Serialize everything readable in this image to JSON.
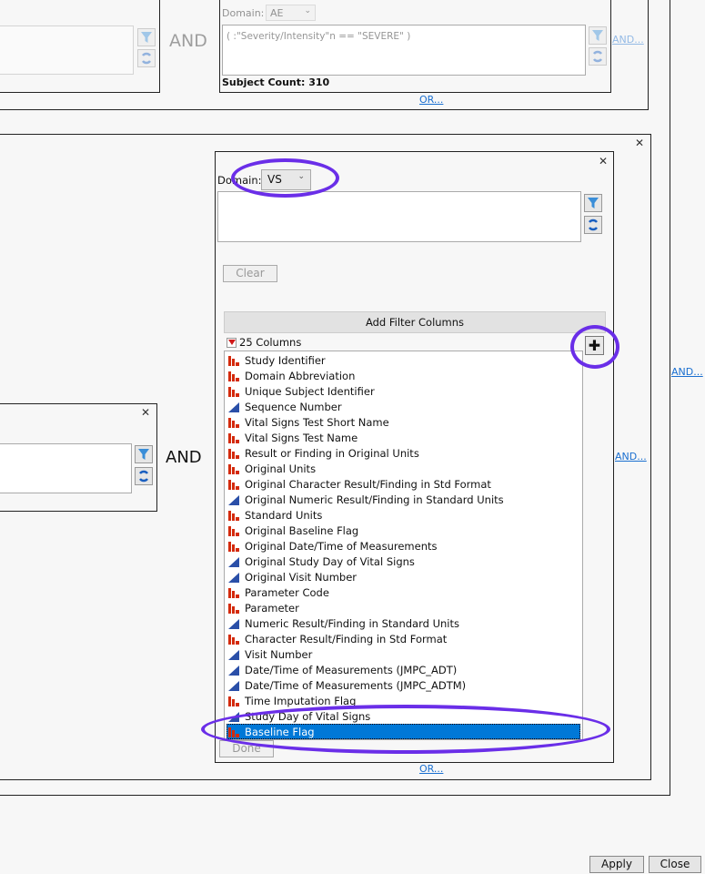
{
  "top_left_panel": {
    "and_label": "AND"
  },
  "top_right_panel": {
    "domain_label": "Domain:",
    "domain_value": "AE",
    "filter_expression": "( :\"Severity/Intensity\"n == \"SEVERE\" )",
    "subject_count": "Subject Count: 310",
    "and_link": "AND...",
    "or_link": "OR..."
  },
  "middle": {
    "and_link_outer": "AND...",
    "and_label": "AND",
    "and_link": "AND..."
  },
  "vs_panel": {
    "domain_label": "Domain:",
    "domain_value": "VS",
    "filter_expression": "",
    "clear_label": "Clear",
    "add_filter_columns_label": "Add Filter Columns",
    "columns_count": "25 Columns",
    "columns": [
      {
        "label": "Study Identifier",
        "type": "nominal"
      },
      {
        "label": "Domain Abbreviation",
        "type": "nominal"
      },
      {
        "label": "Unique Subject Identifier",
        "type": "nominal"
      },
      {
        "label": "Sequence Number",
        "type": "continuous"
      },
      {
        "label": "Vital Signs Test Short Name",
        "type": "nominal"
      },
      {
        "label": "Vital Signs Test Name",
        "type": "nominal"
      },
      {
        "label": "Result or Finding in Original Units",
        "type": "nominal"
      },
      {
        "label": "Original Units",
        "type": "nominal"
      },
      {
        "label": "Original Character Result/Finding in Std Format",
        "type": "nominal"
      },
      {
        "label": "Original Numeric Result/Finding in Standard Units",
        "type": "continuous"
      },
      {
        "label": "Standard Units",
        "type": "nominal"
      },
      {
        "label": "Original Baseline Flag",
        "type": "nominal"
      },
      {
        "label": "Original Date/Time of Measurements",
        "type": "nominal"
      },
      {
        "label": "Original Study Day of Vital Signs",
        "type": "continuous"
      },
      {
        "label": "Original Visit Number",
        "type": "continuous"
      },
      {
        "label": "Parameter Code",
        "type": "nominal"
      },
      {
        "label": "Parameter",
        "type": "nominal"
      },
      {
        "label": "Numeric Result/Finding in Standard Units",
        "type": "continuous"
      },
      {
        "label": "Character Result/Finding in Std Format",
        "type": "nominal"
      },
      {
        "label": "Visit Number",
        "type": "continuous"
      },
      {
        "label": "Date/Time of Measurements (JMPC_ADT)",
        "type": "continuous"
      },
      {
        "label": "Date/Time of Measurements (JMPC_ADTM)",
        "type": "continuous"
      },
      {
        "label": "Time Imputation Flag",
        "type": "nominal"
      },
      {
        "label": "Study Day of Vital Signs",
        "type": "continuous"
      },
      {
        "label": "Baseline Flag",
        "type": "nominal",
        "selected": true
      }
    ],
    "done_label": "Done",
    "or_link": "OR..."
  },
  "footer": {
    "apply_label": "Apply",
    "close_label": "Close"
  },
  "colors": {
    "annotation": "#6a2ee8",
    "selection": "#0078d7",
    "link": "#1a6fd0",
    "nominal_icon": "#d42a0c",
    "continuous_icon": "#2a4fa8"
  }
}
